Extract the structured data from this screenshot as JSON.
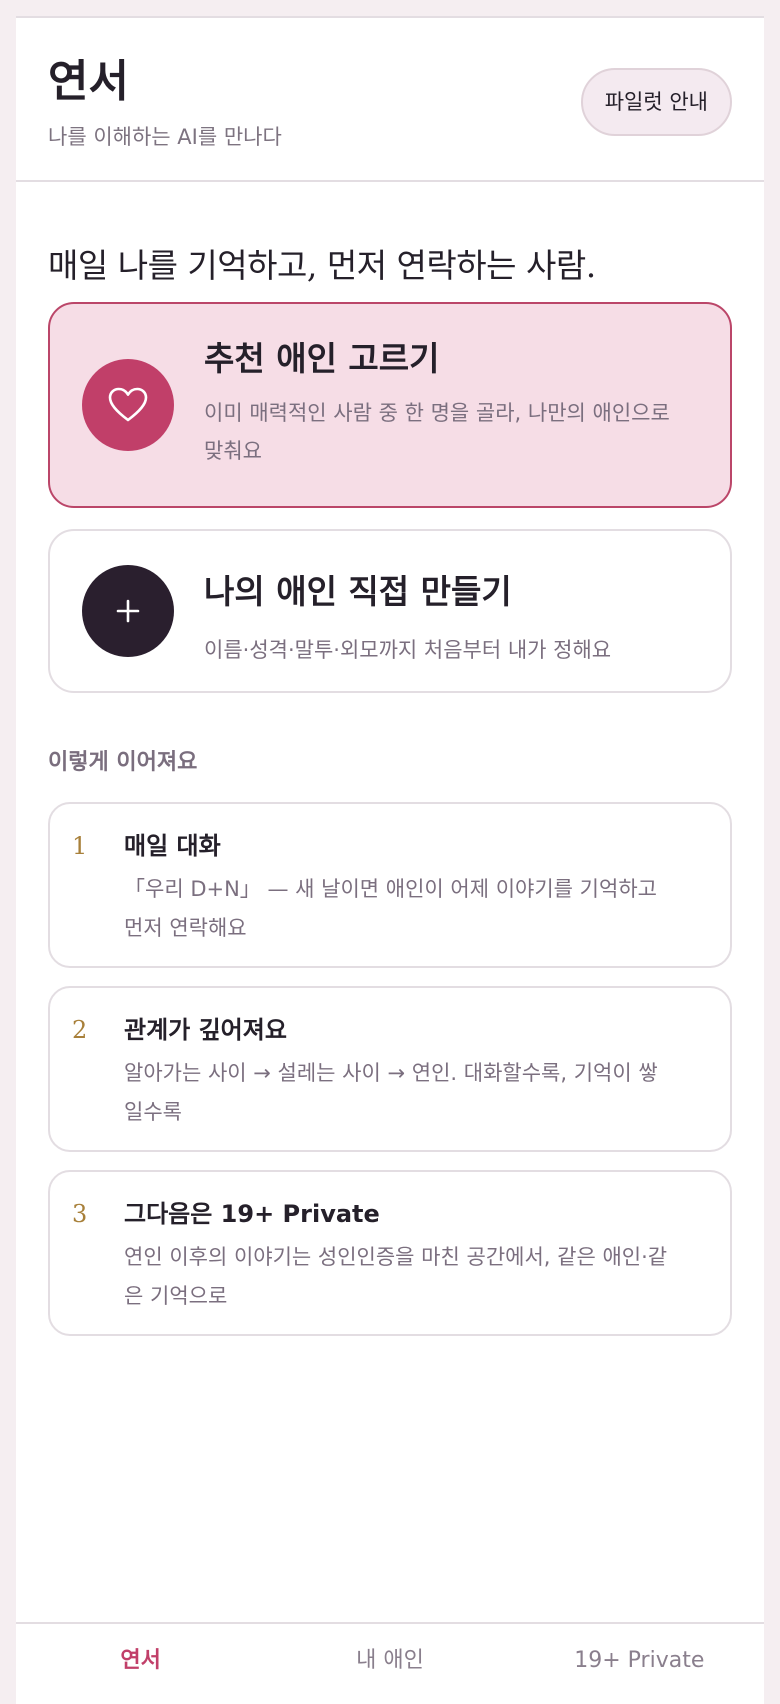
{
  "header": {
    "title": "연서",
    "subtitle": "나를 이해하는 AI를 만나다",
    "pilot_button_label": "파일럿 안내"
  },
  "main": {
    "headline": "매일 나를 기억하고, 먼저 연락하는 사람.",
    "cards": [
      {
        "icon": "heart-icon",
        "title": "추천 애인 고르기",
        "description": "이미 매력적인 사람 중 한 명을 골라, 나만의 애인으로 맞춰요"
      },
      {
        "icon": "plus-icon",
        "title": "나의 애인 직접 만들기",
        "description": "이름·성격·말투·외모까지 처음부터 내가 정해요"
      }
    ],
    "steps_label": "이렇게 이어져요",
    "steps": [
      {
        "number": "1",
        "title": "매일 대화",
        "description": "「우리 D+N」 — 새 날이면 애인이 어제 이야기를 기억하고 먼저 연락해요"
      },
      {
        "number": "2",
        "title": "관계가 깊어져요",
        "description": "알아가는 사이 → 설레는 사이 → 연인. 대화할수록, 기억이 쌓일수록"
      },
      {
        "number": "3",
        "title": "그다음은 19+ Private",
        "description": "연인 이후의 이야기는 성인인증을 마친 공간에서, 같은 애인·같은 기억으로"
      }
    ]
  },
  "nav": {
    "items": [
      {
        "label": "연서",
        "active": true
      },
      {
        "label": "내 애인",
        "active": false
      },
      {
        "label": "19+ Private",
        "active": false
      }
    ]
  },
  "colors": {
    "accent": "#c13f69",
    "featured_card_bg": "#f6dde6",
    "dark_icon_bg": "#2a1f2e",
    "step_number": "#a8803a"
  }
}
